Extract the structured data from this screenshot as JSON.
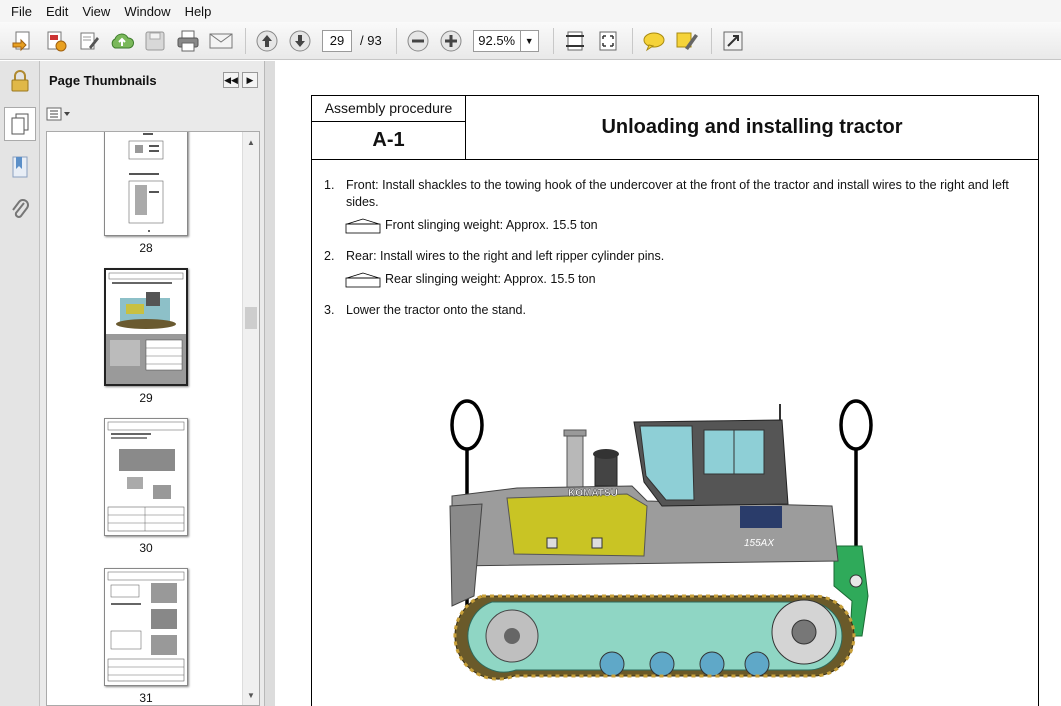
{
  "menu": [
    "File",
    "Edit",
    "View",
    "Window",
    "Help"
  ],
  "toolbar": {
    "page_current": "29",
    "page_total": "/ 93",
    "zoom": "92.5%"
  },
  "panel": {
    "title": "Page Thumbnails",
    "thumbnails": [
      {
        "label": "28"
      },
      {
        "label": "29"
      },
      {
        "label": "30"
      },
      {
        "label": "31"
      }
    ]
  },
  "document": {
    "header_label": "Assembly procedure",
    "header_code": "A-1",
    "title": "Unloading and installing tractor",
    "steps": [
      {
        "num": "1.",
        "text": "Front: Install shackles to the towing hook of the undercover at the front of the tractor and install wires to the right and left sides.",
        "sub": "Front slinging weight: Approx. 15.5 ton"
      },
      {
        "num": "2.",
        "text": "Rear: Install wires to the right and left ripper cylinder pins.",
        "sub": "Rear slinging weight: Approx. 15.5 ton"
      },
      {
        "num": "3.",
        "text": "Lower the tractor onto the stand.",
        "sub": ""
      }
    ],
    "machine_brand": "KOMATSU",
    "machine_model": "155AX"
  }
}
